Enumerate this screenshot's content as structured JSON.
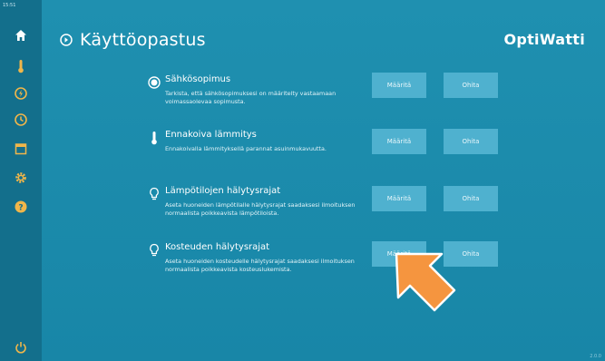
{
  "status": {
    "clock": "15:51"
  },
  "sidebar": {
    "items": [
      {
        "icon": "home-icon"
      },
      {
        "icon": "thermometer-icon"
      },
      {
        "icon": "energy-cycle-icon"
      },
      {
        "icon": "history-icon"
      },
      {
        "icon": "calendar-icon"
      },
      {
        "icon": "gear-icon"
      },
      {
        "icon": "help-icon"
      }
    ],
    "power_icon": "power-icon"
  },
  "header": {
    "title": "Käyttöopastus",
    "brand": "OptiWatti"
  },
  "guide": {
    "items": [
      {
        "icon": "contract-icon",
        "title": "Sähkösopimus",
        "desc": "Tarkista, että sähkösopimuksesi on määritelty vastaamaan voimassaolevaa sopimusta.",
        "set_label": "Määritä",
        "skip_label": "Ohita"
      },
      {
        "icon": "thermometer-icon",
        "title": "Ennakoiva lämmitys",
        "desc": "Ennakoivalla lämmityksellä parannat asuinmukavuutta.",
        "set_label": "Määritä",
        "skip_label": "Ohita"
      },
      {
        "icon": "alert-bulb-icon",
        "title": "Lämpötilojen hälytysrajat",
        "desc": "Aseta huoneiden lämpötilalle hälytysrajat saadaksesi ilmoituksen normaalista poikkeavista lämpötiloista.",
        "set_label": "Määritä",
        "skip_label": "Ohita"
      },
      {
        "icon": "alert-bulb-icon",
        "title": "Kosteuden hälytysrajat",
        "desc": "Aseta huoneiden kosteudelle hälytysrajat saadaksesi ilmoituksen normaalista poikkeavista kosteuslukemista.",
        "set_label": "Määritä",
        "skip_label": "Ohita"
      }
    ]
  },
  "footer": {
    "version": "2.0.0"
  },
  "colors": {
    "background": "#1a86a6",
    "sidebar": "#136f8c",
    "button": "#4fb1cf",
    "pointer": "#f5953f"
  }
}
